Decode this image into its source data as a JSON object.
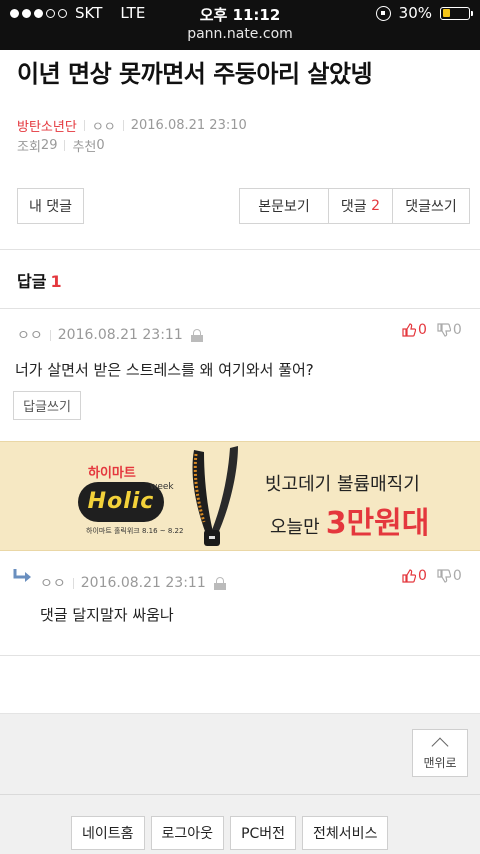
{
  "status_bar": {
    "carrier": "SKT",
    "network": "LTE",
    "time": "오후 11:12",
    "battery": "30%",
    "battery_level": 0.3
  },
  "url": "pann.nate.com",
  "post": {
    "title": "이년 면상 못까면서 주둥아리 살았넹",
    "category": "방탄소년단",
    "author": "ㅇㅇ",
    "date": "2016.08.21 23:10",
    "views_label": "조회",
    "views": "29",
    "recommend_label": "추천",
    "recommend": "0"
  },
  "actions": {
    "my_comments": "내 댓글",
    "view_post": "본문보기",
    "comments_label": "댓글",
    "comments_count": "2",
    "write_comment": "댓글쓰기"
  },
  "replies": {
    "heading": "답글",
    "count": "1"
  },
  "comments": [
    {
      "author": "ㅇㅇ",
      "date": "2016.08.21 23:11",
      "up": "0",
      "down": "0",
      "text": "너가 살면서 받은 스트레스를 왜 여기와서 풀어?",
      "reply_button": "답글쓰기"
    },
    {
      "author": "ㅇㅇ",
      "date": "2016.08.21 23:11",
      "up": "0",
      "down": "0",
      "text": "댓글 달지말자 싸움나"
    }
  ],
  "ad": {
    "brand": "하이마트",
    "logo_text": "Holic",
    "logo_sub": "week",
    "dates": "하이마트 홀릭위크 8.16 ~ 8.22",
    "line1": "빗고데기 볼륨매직기",
    "line2_prefix": "오늘만",
    "line2_price": "3만원대"
  },
  "to_top": "맨위로",
  "footer": [
    "네이트홈",
    "로그아웃",
    "PC버전",
    "전체서비스"
  ],
  "colors": {
    "accent": "#e4373d",
    "ad_bg": "#f6e8c3"
  }
}
